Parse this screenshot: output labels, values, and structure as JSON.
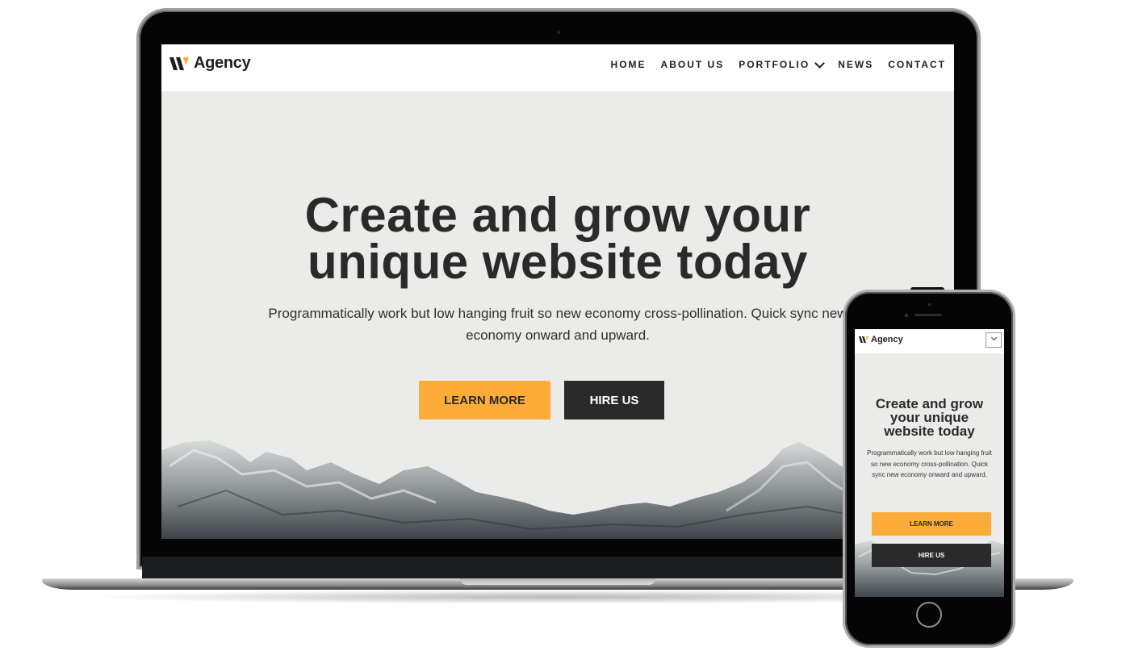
{
  "desktop": {
    "logo": {
      "text": "Agency",
      "icon": "w-logo-icon",
      "accent": "#fdac3a",
      "mark_color": "#1d1f26"
    },
    "nav": [
      {
        "label": "HOME"
      },
      {
        "label": "ABOUT US"
      },
      {
        "label": "PORTFOLIO",
        "has_dropdown": true,
        "icon": "chevron-down-icon"
      },
      {
        "label": "NEWS"
      },
      {
        "label": "CONTACT"
      }
    ],
    "hero": {
      "title_line1": "Create and grow your",
      "title_line2": "unique website today",
      "subtitle": "Programmatically work but low hanging fruit so new economy cross-pollination. Quick sync new economy onward and upward.",
      "primary_button": "LEARN MORE",
      "secondary_button": "HIRE US"
    }
  },
  "mobile": {
    "logo": {
      "text": "Agency",
      "icon": "w-logo-icon"
    },
    "menu_icon": "chevron-down-icon",
    "hero": {
      "title_line1": "Create and grow",
      "title_line2": "your unique",
      "title_line3": "website today",
      "subtitle": "Programmatically work but low hanging fruit so new economy cross-pollination. Quick sync new economy onward and upward.",
      "primary_button": "LEARN MORE",
      "secondary_button": "HIRE US"
    }
  },
  "colors": {
    "accent": "#fdac3a",
    "dark": "#2a2a2a",
    "hero_bg": "#ebebea",
    "device_frame": "#050505"
  }
}
